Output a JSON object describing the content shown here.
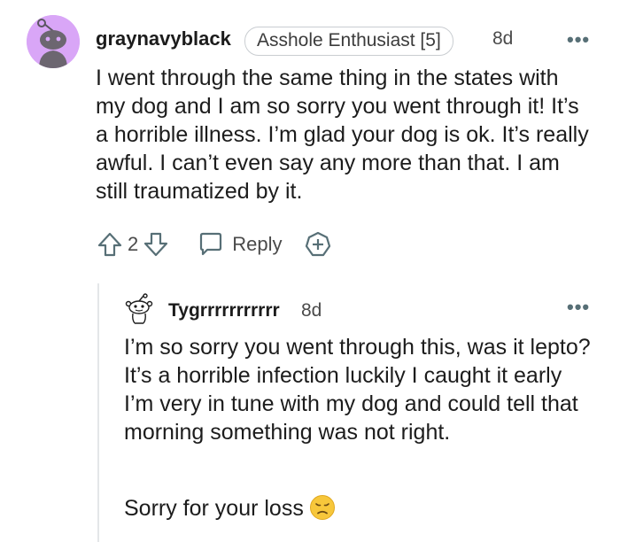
{
  "comment": {
    "username": "graynavyblack",
    "flair": "Asshole Enthusiast [5]",
    "age": "8d",
    "more": "•••",
    "body": "I went through the same thing in the states with my dog and I am so sorry you went through it! It’s a horrible illness. I’m glad your dog is ok. It’s really awful. I can’t even say any more than that. I am still traumatized by it.",
    "score": "2",
    "reply_label": "Reply",
    "icons": {
      "upvote": "arrow-up-icon",
      "downvote": "arrow-down-icon",
      "reply": "speech-bubble-icon",
      "award": "plus-circle-icon",
      "avatar": "snoo-avatar"
    }
  },
  "reply": {
    "username": "Tygrrrrrrrrrrr",
    "age": "8d",
    "more": "•••",
    "paragraph1": "I’m so sorry you went through this, was it lepto? It’s a horrible infection luckily I caught it early I’m very in tune with my dog and could tell that morning something was not right.",
    "paragraph2": "Sorry for your loss",
    "emoji": "disappointed-face-emoji"
  },
  "colors": {
    "avatar_bg": "#d9a6f7",
    "text": "#1c1c1c",
    "meta": "#4a4a4a",
    "icon": "#576f76",
    "thread_line": "#e4e6e8"
  }
}
